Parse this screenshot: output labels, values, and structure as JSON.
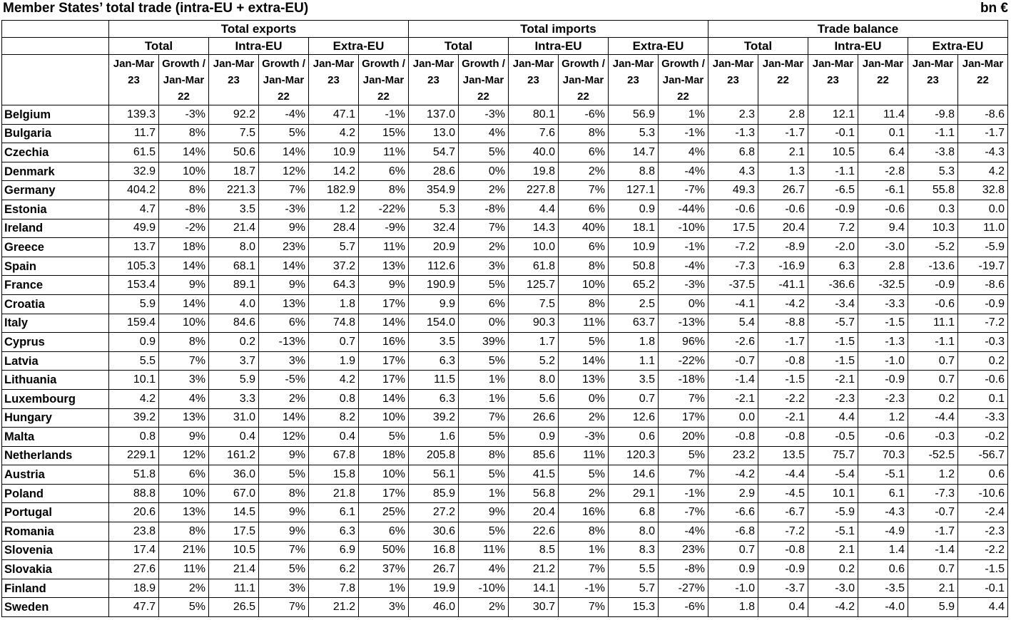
{
  "title": "Member States’ total trade (intra-EU + extra-EU)",
  "unit": "bn €",
  "groups": [
    "Total exports",
    "Total imports",
    "Trade balance"
  ],
  "subgroups": [
    "Total",
    "Intra-EU",
    "Extra-EU",
    "Total",
    "Intra-EU",
    "Extra-EU",
    "Total",
    "Intra-EU",
    "Extra-EU"
  ],
  "colheaders": [
    "Jan-Mar 23",
    "Growth / Jan-Mar 22",
    "Jan-Mar 23",
    "Growth / Jan-Mar 22",
    "Jan-Mar 23",
    "Growth / Jan-Mar 22",
    "Jan-Mar 23",
    "Growth / Jan-Mar 22",
    "Jan-Mar 23",
    "Growth / Jan-Mar 22",
    "Jan-Mar 23",
    "Growth / Jan-Mar 22",
    "Jan-Mar 23",
    "Jan-Mar 22",
    "Jan-Mar 23",
    "Jan-Mar 22",
    "Jan-Mar 23",
    "Jan-Mar 22"
  ],
  "rows": [
    [
      "Belgium",
      "139.3",
      "-3%",
      "92.2",
      "-4%",
      "47.1",
      "-1%",
      "137.0",
      "-3%",
      "80.1",
      "-6%",
      "56.9",
      "1%",
      "2.3",
      "2.8",
      "12.1",
      "11.4",
      "-9.8",
      "-8.6"
    ],
    [
      "Bulgaria",
      "11.7",
      "8%",
      "7.5",
      "5%",
      "4.2",
      "15%",
      "13.0",
      "4%",
      "7.6",
      "8%",
      "5.3",
      "-1%",
      "-1.3",
      "-1.7",
      "-0.1",
      "0.1",
      "-1.1",
      "-1.7"
    ],
    [
      "Czechia",
      "61.5",
      "14%",
      "50.6",
      "14%",
      "10.9",
      "11%",
      "54.7",
      "5%",
      "40.0",
      "6%",
      "14.7",
      "4%",
      "6.8",
      "2.1",
      "10.5",
      "6.4",
      "-3.8",
      "-4.3"
    ],
    [
      "Denmark",
      "32.9",
      "10%",
      "18.7",
      "12%",
      "14.2",
      "6%",
      "28.6",
      "0%",
      "19.8",
      "2%",
      "8.8",
      "-4%",
      "4.3",
      "1.3",
      "-1.1",
      "-2.8",
      "5.3",
      "4.2"
    ],
    [
      "Germany",
      "404.2",
      "8%",
      "221.3",
      "7%",
      "182.9",
      "8%",
      "354.9",
      "2%",
      "227.8",
      "7%",
      "127.1",
      "-7%",
      "49.3",
      "26.7",
      "-6.5",
      "-6.1",
      "55.8",
      "32.8"
    ],
    [
      "Estonia",
      "4.7",
      "-8%",
      "3.5",
      "-3%",
      "1.2",
      "-22%",
      "5.3",
      "-8%",
      "4.4",
      "6%",
      "0.9",
      "-44%",
      "-0.6",
      "-0.6",
      "-0.9",
      "-0.6",
      "0.3",
      "0.0"
    ],
    [
      "Ireland",
      "49.9",
      "-2%",
      "21.4",
      "9%",
      "28.4",
      "-9%",
      "32.4",
      "7%",
      "14.3",
      "40%",
      "18.1",
      "-10%",
      "17.5",
      "20.4",
      "7.2",
      "9.4",
      "10.3",
      "11.0"
    ],
    [
      "Greece",
      "13.7",
      "18%",
      "8.0",
      "23%",
      "5.7",
      "11%",
      "20.9",
      "2%",
      "10.0",
      "6%",
      "10.9",
      "-1%",
      "-7.2",
      "-8.9",
      "-2.0",
      "-3.0",
      "-5.2",
      "-5.9"
    ],
    [
      "Spain",
      "105.3",
      "14%",
      "68.1",
      "14%",
      "37.2",
      "13%",
      "112.6",
      "3%",
      "61.8",
      "8%",
      "50.8",
      "-4%",
      "-7.3",
      "-16.9",
      "6.3",
      "2.8",
      "-13.6",
      "-19.7"
    ],
    [
      "France",
      "153.4",
      "9%",
      "89.1",
      "9%",
      "64.3",
      "9%",
      "190.9",
      "5%",
      "125.7",
      "10%",
      "65.2",
      "-3%",
      "-37.5",
      "-41.1",
      "-36.6",
      "-32.5",
      "-0.9",
      "-8.6"
    ],
    [
      "Croatia",
      "5.9",
      "14%",
      "4.0",
      "13%",
      "1.8",
      "17%",
      "9.9",
      "6%",
      "7.5",
      "8%",
      "2.5",
      "0%",
      "-4.1",
      "-4.2",
      "-3.4",
      "-3.3",
      "-0.6",
      "-0.9"
    ],
    [
      "Italy",
      "159.4",
      "10%",
      "84.6",
      "6%",
      "74.8",
      "14%",
      "154.0",
      "0%",
      "90.3",
      "11%",
      "63.7",
      "-13%",
      "5.4",
      "-8.8",
      "-5.7",
      "-1.5",
      "11.1",
      "-7.2"
    ],
    [
      "Cyprus",
      "0.9",
      "8%",
      "0.2",
      "-13%",
      "0.7",
      "16%",
      "3.5",
      "39%",
      "1.7",
      "5%",
      "1.8",
      "96%",
      "-2.6",
      "-1.7",
      "-1.5",
      "-1.3",
      "-1.1",
      "-0.3"
    ],
    [
      "Latvia",
      "5.5",
      "7%",
      "3.7",
      "3%",
      "1.9",
      "17%",
      "6.3",
      "5%",
      "5.2",
      "14%",
      "1.1",
      "-22%",
      "-0.7",
      "-0.8",
      "-1.5",
      "-1.0",
      "0.7",
      "0.2"
    ],
    [
      "Lithuania",
      "10.1",
      "3%",
      "5.9",
      "-5%",
      "4.2",
      "17%",
      "11.5",
      "1%",
      "8.0",
      "13%",
      "3.5",
      "-18%",
      "-1.4",
      "-1.5",
      "-2.1",
      "-0.9",
      "0.7",
      "-0.6"
    ],
    [
      "Luxembourg",
      "4.2",
      "4%",
      "3.3",
      "2%",
      "0.8",
      "14%",
      "6.3",
      "1%",
      "5.6",
      "0%",
      "0.7",
      "7%",
      "-2.1",
      "-2.2",
      "-2.3",
      "-2.3",
      "0.2",
      "0.1"
    ],
    [
      "Hungary",
      "39.2",
      "13%",
      "31.0",
      "14%",
      "8.2",
      "10%",
      "39.2",
      "7%",
      "26.6",
      "2%",
      "12.6",
      "17%",
      "0.0",
      "-2.1",
      "4.4",
      "1.2",
      "-4.4",
      "-3.3"
    ],
    [
      "Malta",
      "0.8",
      "9%",
      "0.4",
      "12%",
      "0.4",
      "5%",
      "1.6",
      "5%",
      "0.9",
      "-3%",
      "0.6",
      "20%",
      "-0.8",
      "-0.8",
      "-0.5",
      "-0.6",
      "-0.3",
      "-0.2"
    ],
    [
      "Netherlands",
      "229.1",
      "12%",
      "161.2",
      "9%",
      "67.8",
      "18%",
      "205.8",
      "8%",
      "85.6",
      "11%",
      "120.3",
      "5%",
      "23.2",
      "13.5",
      "75.7",
      "70.3",
      "-52.5",
      "-56.7"
    ],
    [
      "Austria",
      "51.8",
      "6%",
      "36.0",
      "5%",
      "15.8",
      "10%",
      "56.1",
      "5%",
      "41.5",
      "5%",
      "14.6",
      "7%",
      "-4.2",
      "-4.4",
      "-5.4",
      "-5.1",
      "1.2",
      "0.6"
    ],
    [
      "Poland",
      "88.8",
      "10%",
      "67.0",
      "8%",
      "21.8",
      "17%",
      "85.9",
      "1%",
      "56.8",
      "2%",
      "29.1",
      "-1%",
      "2.9",
      "-4.5",
      "10.1",
      "6.1",
      "-7.3",
      "-10.6"
    ],
    [
      "Portugal",
      "20.6",
      "13%",
      "14.5",
      "9%",
      "6.1",
      "25%",
      "27.2",
      "9%",
      "20.4",
      "16%",
      "6.8",
      "-7%",
      "-6.6",
      "-6.7",
      "-5.9",
      "-4.3",
      "-0.7",
      "-2.4"
    ],
    [
      "Romania",
      "23.8",
      "8%",
      "17.5",
      "9%",
      "6.3",
      "6%",
      "30.6",
      "5%",
      "22.6",
      "8%",
      "8.0",
      "-4%",
      "-6.8",
      "-7.2",
      "-5.1",
      "-4.9",
      "-1.7",
      "-2.3"
    ],
    [
      "Slovenia",
      "17.4",
      "21%",
      "10.5",
      "7%",
      "6.9",
      "50%",
      "16.8",
      "11%",
      "8.5",
      "1%",
      "8.3",
      "23%",
      "0.7",
      "-0.8",
      "2.1",
      "1.4",
      "-1.4",
      "-2.2"
    ],
    [
      "Slovakia",
      "27.6",
      "11%",
      "21.4",
      "5%",
      "6.2",
      "37%",
      "26.7",
      "4%",
      "21.2",
      "7%",
      "5.5",
      "-8%",
      "0.9",
      "-0.9",
      "0.2",
      "0.6",
      "0.7",
      "-1.5"
    ],
    [
      "Finland",
      "18.9",
      "2%",
      "11.1",
      "3%",
      "7.8",
      "1%",
      "19.9",
      "-10%",
      "14.1",
      "-1%",
      "5.7",
      "-27%",
      "-1.0",
      "-3.7",
      "-3.0",
      "-3.5",
      "2.1",
      "-0.1"
    ],
    [
      "Sweden",
      "47.7",
      "5%",
      "26.5",
      "7%",
      "21.2",
      "3%",
      "46.0",
      "2%",
      "30.7",
      "7%",
      "15.3",
      "-6%",
      "1.8",
      "0.4",
      "-4.2",
      "-4.0",
      "5.9",
      "4.4"
    ]
  ]
}
